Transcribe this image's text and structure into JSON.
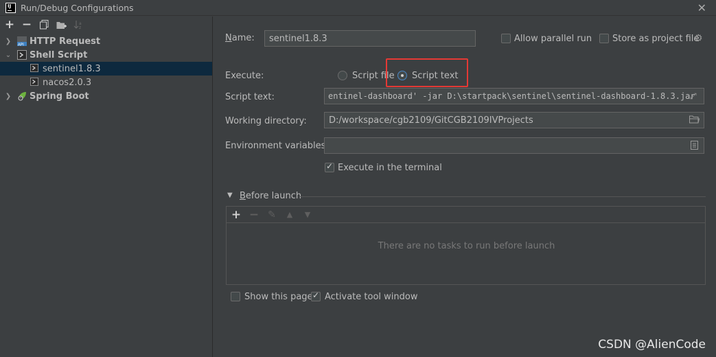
{
  "window": {
    "title": "Run/Debug Configurations",
    "app_logo": "IJ"
  },
  "toolbar": {
    "add": "+",
    "remove": "−",
    "copy": "⧉",
    "new_folder": "▣",
    "sort": "↓²"
  },
  "tree": {
    "http_request": "HTTP Request",
    "shell_script": "Shell Script",
    "sentinel": "sentinel1.8.3",
    "nacos": "nacos2.0.3",
    "spring_boot": "Spring Boot"
  },
  "form": {
    "name_label": "Name:",
    "name_value": "sentinel1.8.3",
    "allow_parallel": "Allow parallel run",
    "store_as_project": "Store as project file",
    "execute_label": "Execute:",
    "script_file": "Script file",
    "script_text": "Script text",
    "script_text_label": "Script text:",
    "script_text_value": "entinel-dashboard' -jar D:\\startpack\\sentinel\\sentinel-dashboard-1.8.3.jar",
    "working_dir_label": "Working directory:",
    "working_dir_value": "D:/workspace/cgb2109/GitCGB2109IVProjects",
    "env_label": "Environment variables:",
    "env_value": "",
    "execute_in_terminal": "Execute in the terminal"
  },
  "before_launch": {
    "title": "Before launch",
    "empty": "There are no tasks to run before launch"
  },
  "footer": {
    "show_page": "Show this page",
    "activate_tool": "Activate tool window"
  },
  "watermark": "CSDN @AlienCode",
  "colors": {
    "background": "#3c3f41",
    "selection": "#0d293e",
    "highlight": "#e53935",
    "field": "#45494a"
  }
}
